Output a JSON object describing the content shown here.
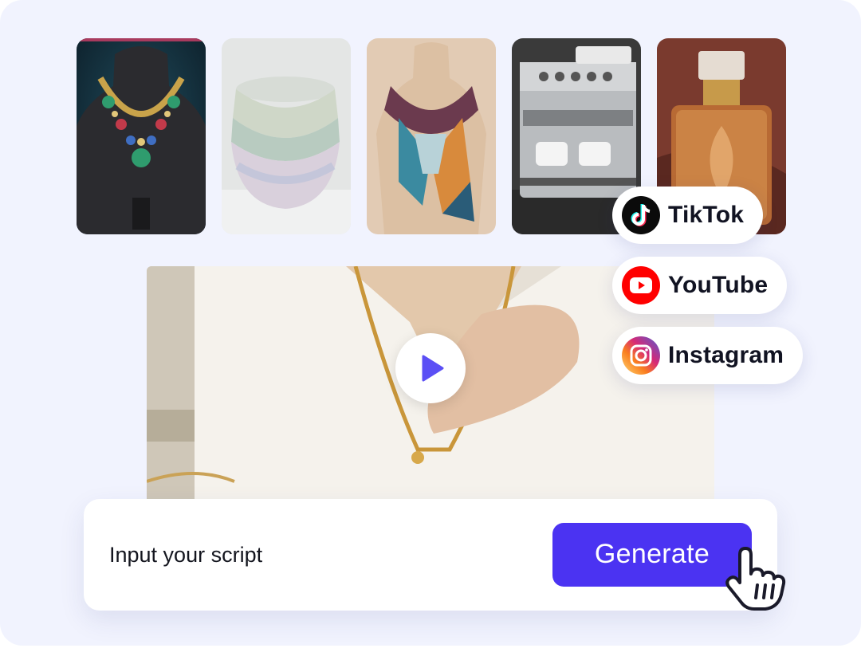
{
  "gallery": {
    "thumbnails": [
      {
        "label": "necklace"
      },
      {
        "label": "bowls"
      },
      {
        "label": "scarf"
      },
      {
        "label": "coffee-machine"
      },
      {
        "label": "perfume"
      }
    ]
  },
  "video": {
    "play_icon": "play-icon"
  },
  "platforms": [
    {
      "label": "TikTok",
      "icon": "tiktok-icon"
    },
    {
      "label": "YouTube",
      "icon": "youtube-icon"
    },
    {
      "label": "Instagram",
      "icon": "instagram-icon"
    }
  ],
  "script": {
    "placeholder": "Input your script",
    "generate_label": "Generate"
  },
  "colors": {
    "accent": "#4b33f2",
    "play": "#5b4ff5",
    "background": "#f1f3fe",
    "youtube_red": "#ff0000"
  },
  "cursor": {
    "icon": "hand-pointer-icon"
  }
}
